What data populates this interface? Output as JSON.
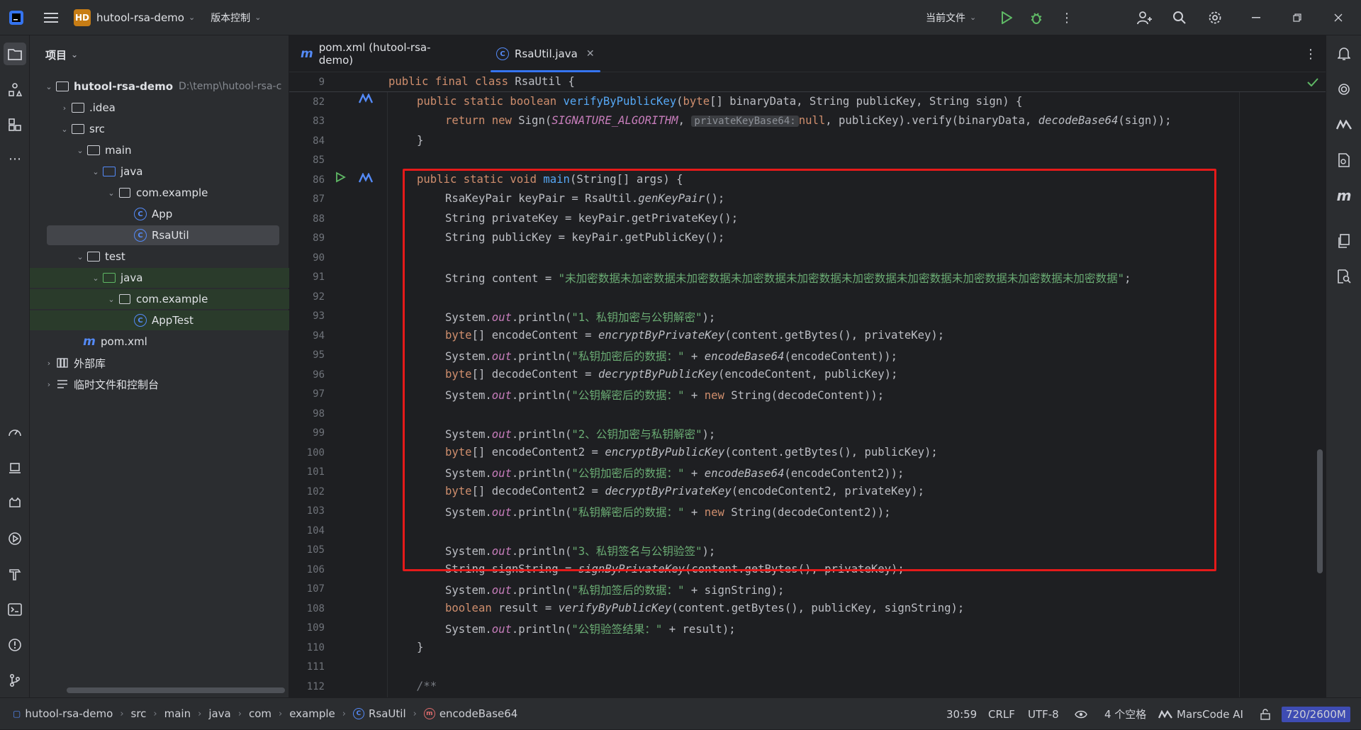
{
  "titlebar": {
    "project_badge": "HD",
    "project_name": "hutool-rsa-demo",
    "vcs_label": "版本控制",
    "run_config": "当前文件"
  },
  "project_panel": {
    "title": "项目",
    "tree": [
      {
        "label": "hutool-rsa-demo",
        "hint": "D:\\temp\\hutool-rsa-c"
      },
      {
        "label": ".idea"
      },
      {
        "label": "src"
      },
      {
        "label": "main"
      },
      {
        "label": "java"
      },
      {
        "label": "com.example"
      },
      {
        "label": "App"
      },
      {
        "label": "RsaUtil"
      },
      {
        "label": "test"
      },
      {
        "label": "java"
      },
      {
        "label": "com.example"
      },
      {
        "label": "AppTest"
      },
      {
        "label": "pom.xml"
      },
      {
        "label": "外部库"
      },
      {
        "label": "临时文件和控制台"
      }
    ]
  },
  "tabs": [
    {
      "label": "pom.xml (hutool-rsa-demo)"
    },
    {
      "label": "RsaUtil.java"
    }
  ],
  "editor": {
    "inlay_hint": "privateKeyBase64:",
    "line_numbers": [
      "9",
      "82",
      "83",
      "84",
      "85",
      "86",
      "87",
      "88",
      "89",
      "90",
      "91",
      "92",
      "93",
      "94",
      "95",
      "96",
      "97",
      "98",
      "99",
      "100",
      "101",
      "102",
      "103",
      "104",
      "105",
      "106",
      "107",
      "108",
      "109",
      "110",
      "111",
      "112"
    ],
    "strings": {
      "content": "\"未加密数据未加密数据未加密数据未加密数据未加密数据未加密数据未加密数据未加密数据未加密数据未加密数据\"",
      "s1": "\"1、私钥加密与公钥解密\"",
      "s2": "\"私钥加密后的数据：\"",
      "s3": "\"公钥解密后的数据：\"",
      "s4": "\"2、公钥加密与私钥解密\"",
      "s5": "\"公钥加密后的数据：\"",
      "s6": "\"私钥解密后的数据：\"",
      "s7": "\"3、私钥签名与公钥验签\"",
      "s8": "\"私钥加签后的数据：\"",
      "s9": "\"公钥验签结果：\""
    }
  },
  "statusbar": {
    "breadcrumb": [
      "hutool-rsa-demo",
      "src",
      "main",
      "java",
      "com",
      "example",
      "RsaUtil",
      "encodeBase64"
    ],
    "position": "30:59",
    "line_sep": "CRLF",
    "encoding": "UTF-8",
    "indent": "4 个空格",
    "ai": "MarsCode AI",
    "memory": "720/2600M"
  }
}
